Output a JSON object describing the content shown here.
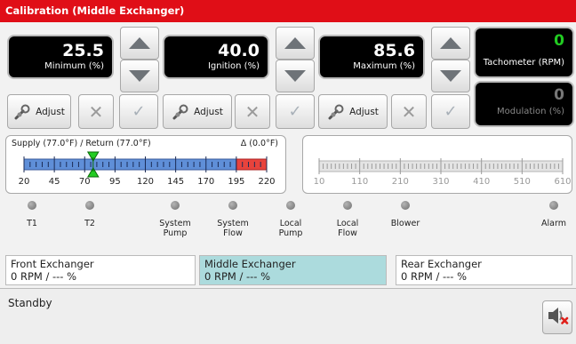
{
  "window": {
    "title": "Calibration (Middle Exchanger)"
  },
  "readouts": {
    "minimum": {
      "value": "25.5",
      "label": "Minimum (%)"
    },
    "ignition": {
      "value": "40.0",
      "label": "Ignition (%)"
    },
    "maximum": {
      "value": "85.6",
      "label": "Maximum (%)"
    },
    "tachometer": {
      "value": "0",
      "label": "Tachometer (RPM)",
      "value_color": "#22cc22"
    },
    "modulation": {
      "value": "0",
      "label": "Modulation (%)",
      "value_color": "#777777"
    }
  },
  "controls": {
    "adjust_label": "Adjust",
    "cancel_icon": "x-icon",
    "confirm_icon": "check-icon"
  },
  "temperature": {
    "title": "Supply (77.0°F) / Return (77.0°F)",
    "delta": "Δ (0.0°F)",
    "scale_min": 20,
    "scale_max": 220,
    "ticks": [
      "20",
      "45",
      "70",
      "95",
      "120",
      "145",
      "170",
      "195",
      "220"
    ],
    "red_zone_start": 195,
    "supply_marker": 77,
    "return_marker": 77,
    "bar_color": "#5f8fd8",
    "red_color": "#e8433c",
    "marker_color": "#22cc22"
  },
  "secondary_scale": {
    "ticks": [
      "10",
      "110",
      "210",
      "310",
      "410",
      "510",
      "610"
    ]
  },
  "indicators": [
    {
      "label": "T1"
    },
    {
      "label": "T2"
    },
    {
      "label": "System\nPump"
    },
    {
      "label": "System\nFlow"
    },
    {
      "label": "Local\nPump"
    },
    {
      "label": "Local\nFlow"
    },
    {
      "label": "Blower"
    },
    {
      "label": "Alarm"
    }
  ],
  "exchangers": [
    {
      "name": "Front Exchanger",
      "status": "0 RPM / --- %"
    },
    {
      "name": "Middle Exchanger",
      "status": "0 RPM / --- %",
      "active": true
    },
    {
      "name": "Rear Exchanger",
      "status": "0 RPM / --- %"
    }
  ],
  "status": {
    "text": "Standby",
    "mute_icon": "speaker-muted-icon"
  }
}
